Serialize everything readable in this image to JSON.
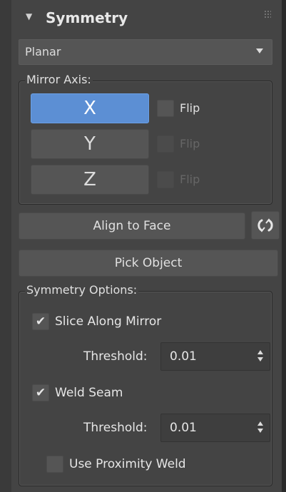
{
  "header": {
    "title": "Symmetry"
  },
  "mode_select": {
    "value": "Planar"
  },
  "mirror_axis": {
    "label": "Mirror Axis:",
    "axes": [
      {
        "label": "X",
        "active": true,
        "flip_label": "Flip",
        "flip_enabled": true
      },
      {
        "label": "Y",
        "active": false,
        "flip_label": "Flip",
        "flip_enabled": false
      },
      {
        "label": "Z",
        "active": false,
        "flip_label": "Flip",
        "flip_enabled": false
      }
    ]
  },
  "align_to_face": {
    "label": "Align to Face"
  },
  "pick_object": {
    "label": "Pick Object"
  },
  "symmetry_options": {
    "label": "Symmetry Options:",
    "slice_along_mirror": {
      "label": "Slice Along Mirror",
      "checked": true
    },
    "slice_threshold": {
      "label": "Threshold:",
      "value": "0.01"
    },
    "weld_seam": {
      "label": "Weld Seam",
      "checked": true
    },
    "weld_threshold": {
      "label": "Threshold:",
      "value": "0.01"
    },
    "use_proximity_weld": {
      "label": "Use Proximity Weld",
      "checked": false
    }
  },
  "colors": {
    "accent": "#5c8fd4",
    "panel_bg": "#444444",
    "button_bg": "#555555"
  },
  "icons": {
    "rollout_toggle": "collapse-arrow-icon",
    "grip": "grip-icon",
    "dropdown": "chevron-down-icon",
    "reset": "refresh-icon",
    "checkmark": "checkmark-icon"
  }
}
